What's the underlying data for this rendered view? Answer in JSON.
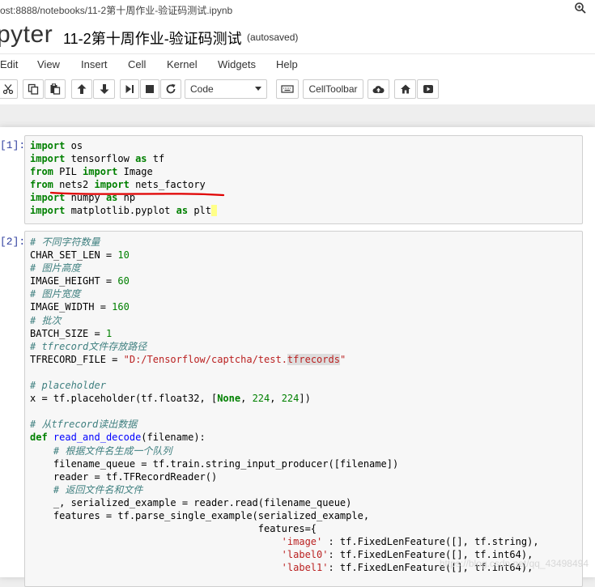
{
  "browser": {
    "url": "ost:8888/notebooks/11-2第十周作业-验证码测试.ipynb",
    "zoom_icon": "zoom-icon"
  },
  "header": {
    "logo": "pyter",
    "notebook_name": "11-2第十周作业-验证码测试",
    "status": "(autosaved)"
  },
  "menu": [
    "Edit",
    "View",
    "Insert",
    "Cell",
    "Kernel",
    "Widgets",
    "Help"
  ],
  "toolbar": {
    "cell_type": "Code",
    "celltoolbar_label": "CellToolbar",
    "buttons": [
      "cut-icon",
      "copy-icon",
      "paste-icon",
      "move-up-icon",
      "move-down-icon",
      "run-icon",
      "stop-icon",
      "restart-icon",
      "keyboard-icon",
      "upload-icon",
      "home-icon",
      "present-icon"
    ]
  },
  "cells": [
    {
      "prompt": "[1]:",
      "lines": [
        "import os",
        "import tensorflow as tf",
        "from PIL import Image",
        "from nets2 import nets_factory",
        "import numpy as np",
        "import matplotlib.pyplot as plt"
      ]
    },
    {
      "prompt": "[2]:",
      "lines": [
        "# 不同字符数量",
        "CHAR_SET_LEN = 10",
        "# 图片高度",
        "IMAGE_HEIGHT = 60",
        "# 图片宽度",
        "IMAGE_WIDTH = 160",
        "# 批次",
        "BATCH_SIZE = 1",
        "# tfrecord文件存放路径",
        "TFRECORD_FILE = \"D:/Tensorflow/captcha/test.tfrecords\"",
        "",
        "# placeholder",
        "x = tf.placeholder(tf.float32, [None, 224, 224])",
        "",
        "# 从tfrecord读出数据",
        "def read_and_decode(filename):",
        "    # 根据文件名生成一个队列",
        "    filename_queue = tf.train.string_input_producer([filename])",
        "    reader = tf.TFRecordReader()",
        "    # 返回文件名和文件",
        "    _, serialized_example = reader.read(filename_queue)",
        "    features = tf.parse_single_example(serialized_example,",
        "                                       features={",
        "                                           'image' : tf.FixedLenFeature([], tf.string),",
        "                                           'label0': tf.FixedLenFeature([], tf.int64),",
        "                                           'label1': tf.FixedLenFeature([], tf.int64),"
      ]
    }
  ],
  "watermark": "https://blog.csdn.net/qq_43498494"
}
